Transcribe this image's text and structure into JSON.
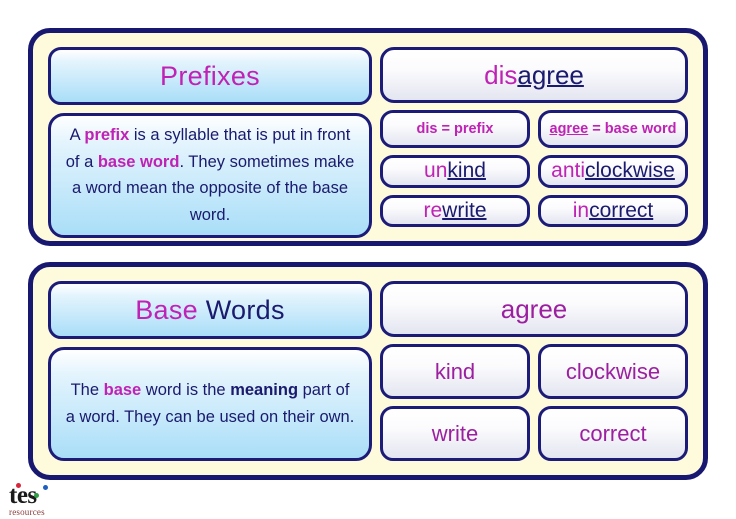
{
  "document": {
    "title": "Prefixes and Base Words poster"
  },
  "panels": [
    {
      "id": "prefixes",
      "title_plain": "Prefixes",
      "title_parts": [
        {
          "text": "Prefixes",
          "style": "magenta"
        }
      ],
      "body_plain": "A prefix is a syllable that is put in front of a base word. They sometimes make a word mean the opposite of the base word.",
      "body_parts": [
        {
          "text": "A ",
          "style": "navy"
        },
        {
          "text": "prefix",
          "style": "magenta-bold"
        },
        {
          "text": " is a syllable that is put in front of a ",
          "style": "navy"
        },
        {
          "text": "base word",
          "style": "magenta-bold"
        },
        {
          "text": ". They sometimes make a word mean the opposite of the base word.",
          "style": "navy"
        }
      ],
      "headword": {
        "prefix": "dis",
        "base": "agree",
        "full": "disagree"
      },
      "definitions": [
        {
          "term": "dis",
          "term_underlined": false,
          "equals": "=",
          "meaning": "prefix",
          "full": "dis = prefix"
        },
        {
          "term": "agree",
          "term_underlined": true,
          "equals": "=",
          "meaning": "base word",
          "full": "agree = base word"
        }
      ],
      "examples": [
        {
          "prefix": "un",
          "base": "kind",
          "full": "unkind"
        },
        {
          "prefix": "anti",
          "base": "clockwise",
          "full": "anticlockwise"
        },
        {
          "prefix": "re",
          "base": "write",
          "full": "rewrite"
        },
        {
          "prefix": "in",
          "base": "correct",
          "full": "incorrect"
        }
      ]
    },
    {
      "id": "basewords",
      "title_plain": "Base Words",
      "title_parts": [
        {
          "text": "Base",
          "style": "magenta"
        },
        {
          "text": " Words",
          "style": "navy"
        }
      ],
      "body_plain": "The base word is the meaning part of a word. They can be used on their own.",
      "body_parts": [
        {
          "text": "The ",
          "style": "navy"
        },
        {
          "text": "base",
          "style": "magenta-bold"
        },
        {
          "text": " word is the ",
          "style": "navy"
        },
        {
          "text": "meaning",
          "style": "navy-bold"
        },
        {
          "text": " part of a word. They can be used on their own.",
          "style": "navy"
        }
      ],
      "headword": {
        "full": "agree"
      },
      "words": [
        {
          "full": "kind"
        },
        {
          "full": "clockwise"
        },
        {
          "full": "write"
        },
        {
          "full": "correct"
        }
      ]
    }
  ],
  "logo": {
    "mark": "tes",
    "subtitle": "resources"
  },
  "colors": {
    "border_navy": "#181870",
    "panel_cream": "#fdfbdc",
    "magenta": "#bf22b4",
    "navy_text": "#1a1a6e",
    "purple": "#9c1fa0",
    "blue_box_bottom": "#a9def8",
    "page_background": "#ffffff"
  }
}
